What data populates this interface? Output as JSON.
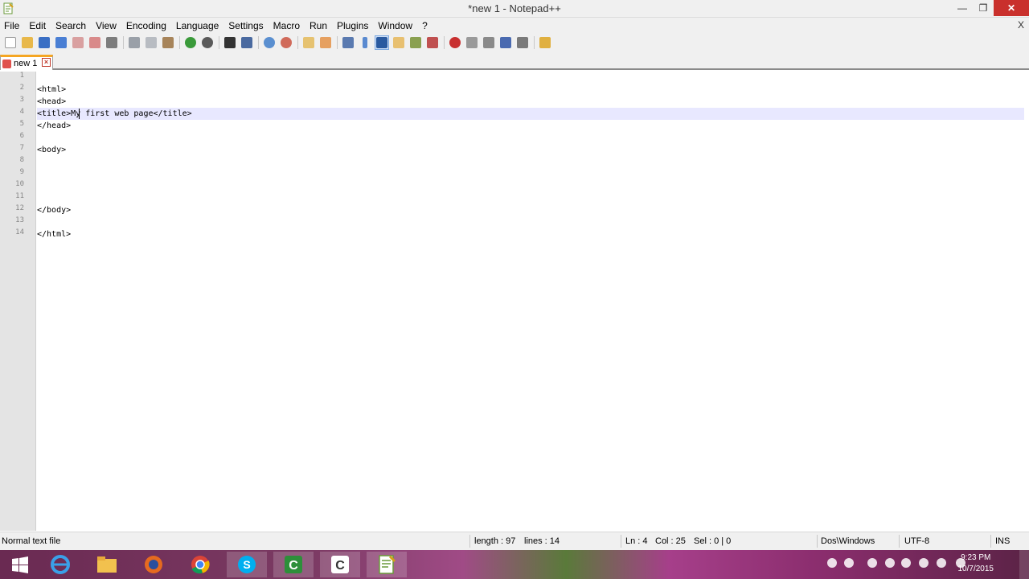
{
  "window": {
    "title": "*new 1 - Notepad++",
    "controls": [
      "minimize-icon",
      "maximize-icon",
      "close-icon"
    ]
  },
  "menu": {
    "items": [
      "File",
      "Edit",
      "Search",
      "View",
      "Encoding",
      "Language",
      "Settings",
      "Macro",
      "Run",
      "Plugins",
      "Window",
      "?"
    ],
    "close_doc": "X"
  },
  "toolbar": {
    "icons": [
      "new-file-icon",
      "open-file-icon",
      "save-icon",
      "save-all-icon",
      "close-icon",
      "close-all-icon",
      "print-icon",
      "cut-icon",
      "copy-icon",
      "paste-icon",
      "undo-icon",
      "redo-icon",
      "find-icon",
      "replace-icon",
      "zoom-in-icon",
      "zoom-out-icon",
      "sync-vertical-icon",
      "sync-horizontal-icon",
      "word-wrap-icon",
      "all-characters-icon",
      "indent-guide-icon",
      "doc-map-icon",
      "function-list-icon",
      "folder-workspace-icon",
      "record-macro-icon",
      "stop-macro-icon",
      "play-macro-icon",
      "run-macro-multiple-icon",
      "save-macro-icon",
      "open-folder-icon"
    ],
    "active_icon": "indent-guide-icon"
  },
  "tabs": [
    {
      "label": "new 1",
      "icon": "unsaved-document-icon",
      "close": "close-tab-icon"
    }
  ],
  "editor": {
    "lines": [
      "",
      "<html>",
      "<head>",
      "<title>My first web page</title>",
      "</head>",
      "",
      "<body>",
      "",
      "",
      "",
      "",
      "</body>",
      "",
      "</html>"
    ],
    "line_numbers": [
      "1",
      "2",
      "3",
      "4",
      "5",
      "6",
      "7",
      "8",
      "9",
      "10",
      "11",
      "12",
      "13",
      "14"
    ],
    "current_line": 4
  },
  "status": {
    "file_type": "Normal text file",
    "length": "length : 97",
    "lines": "lines : 14",
    "ln": "Ln : 4",
    "col": "Col : 25",
    "sel": "Sel : 0 | 0",
    "eol": "Dos\\Windows",
    "encoding": "UTF-8",
    "mode": "INS"
  },
  "taskbar": {
    "apps": [
      "windows-start-icon",
      "internet-explorer-icon",
      "file-explorer-icon",
      "firefox-icon",
      "chrome-icon",
      "skype-icon",
      "camtasia-recorder-icon",
      "camtasia-studio-icon",
      "notepad-plus-plus-icon"
    ],
    "active_app": "notepad-plus-plus-icon",
    "clock_time": "9:23 PM",
    "clock_date": "10/7/2015"
  }
}
